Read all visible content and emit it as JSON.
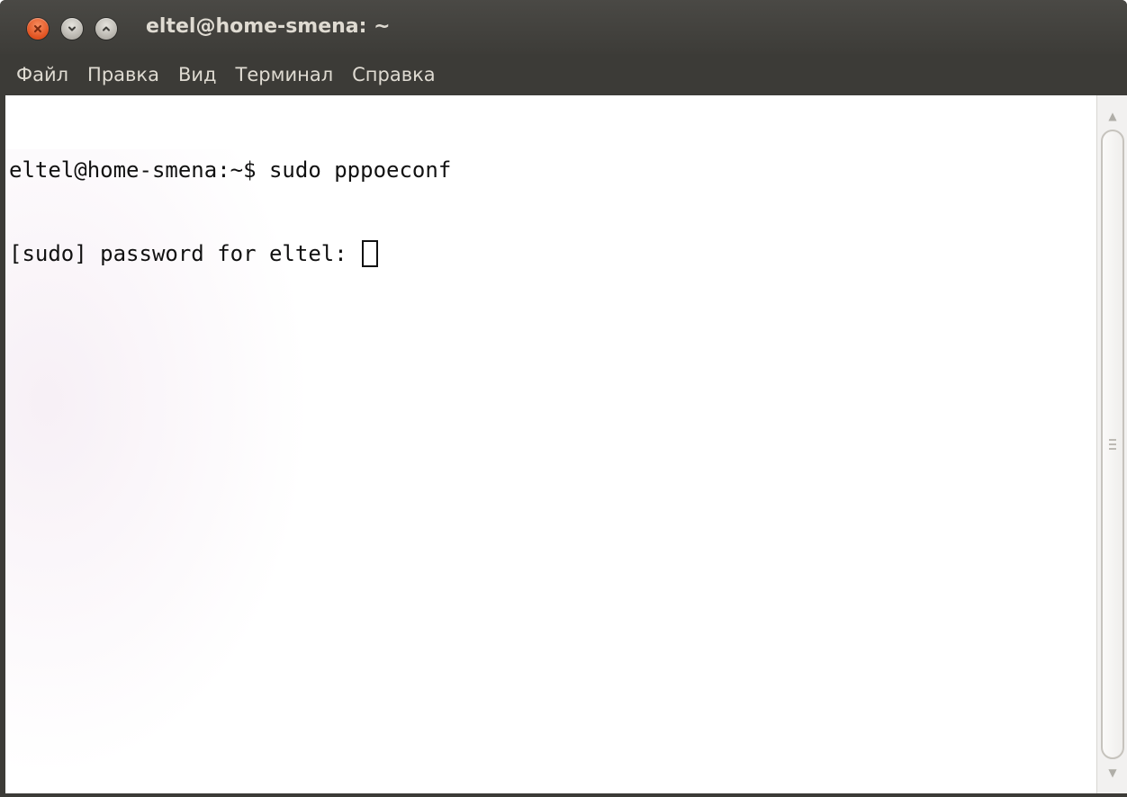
{
  "window": {
    "title": "eltel@home-smena: ~"
  },
  "menu": {
    "items": [
      "Файл",
      "Правка",
      "Вид",
      "Терминал",
      "Справка"
    ]
  },
  "terminal": {
    "lines": [
      "eltel@home-smena:~$ sudo pppoeconf",
      "[sudo] password for eltel: "
    ]
  },
  "icons": {
    "close": "close-icon",
    "minimize": "minimize-icon",
    "maximize": "maximize-icon",
    "scroll_up": "scroll-up-arrow-icon",
    "scroll_down": "scroll-down-arrow-icon"
  },
  "colors": {
    "titlebar_bg": "#3c3b37",
    "titlebar_text": "#dfdbd2",
    "close_button": "#e0511f",
    "terminal_bg": "#ffffff",
    "terminal_text": "#111111"
  }
}
